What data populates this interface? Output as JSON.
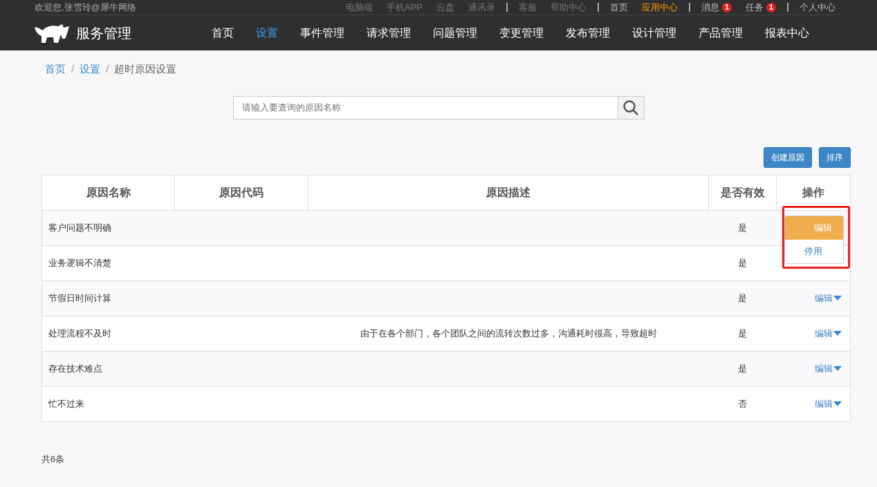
{
  "top_bar": {
    "welcome": "欢迎您,张雪玲@犀牛网络",
    "links": [
      {
        "label": "电脑端",
        "kind": "muted"
      },
      {
        "label": "手机APP",
        "kind": "muted"
      },
      {
        "label": "云盘",
        "kind": "muted"
      },
      {
        "label": "通讯录",
        "kind": "muted"
      },
      {
        "kind": "divider"
      },
      {
        "label": "客服",
        "kind": "muted"
      },
      {
        "label": "帮助中心",
        "kind": "muted"
      },
      {
        "kind": "divider"
      },
      {
        "label": "首页",
        "kind": "normal"
      },
      {
        "label": "应用中心",
        "kind": "highlight"
      },
      {
        "kind": "divider"
      },
      {
        "label": "消息",
        "kind": "normal",
        "badge": "1"
      },
      {
        "label": "任务",
        "kind": "normal",
        "badge": "1"
      },
      {
        "kind": "divider"
      },
      {
        "label": "个人中心",
        "kind": "normal"
      }
    ]
  },
  "nav": {
    "brand": "服务管理",
    "items": [
      {
        "label": "首页",
        "selected": false
      },
      {
        "label": "设置",
        "selected": true
      },
      {
        "label": "事件管理",
        "selected": false
      },
      {
        "label": "请求管理",
        "selected": false
      },
      {
        "label": "问题管理",
        "selected": false
      },
      {
        "label": "变更管理",
        "selected": false
      },
      {
        "label": "发布管理",
        "selected": false
      },
      {
        "label": "设计管理",
        "selected": false
      },
      {
        "label": "产品管理",
        "selected": false
      },
      {
        "label": "报表中心",
        "selected": false
      }
    ]
  },
  "breadcrumb": {
    "separator": "/",
    "items": [
      "首页",
      "设置",
      "超时原因设置"
    ]
  },
  "search": {
    "placeholder": "请输入要查询的原因名称"
  },
  "buttons": [
    "创建原因",
    "排序"
  ],
  "table": {
    "columns": [
      "原因名称",
      "原因代码",
      "原因描述",
      "是否有效",
      "操作"
    ],
    "rows": [
      {
        "name": "客户问题不明确",
        "valid": "是"
      },
      {
        "name": "业务逻辑不清楚",
        "valid": "是"
      },
      {
        "name": "节假日时间计算",
        "valid": "是",
        "action": "编辑"
      },
      {
        "name": "处理流程不及时",
        "description": "由于在各个部门，各个团队之间的流转次数过多，沟通耗时很高，导致超时",
        "valid": "是",
        "action": "编辑"
      },
      {
        "name": "存在技术难点",
        "valid": "是",
        "action": "编辑"
      },
      {
        "name": "忙不过来",
        "valid": "否",
        "action": "编辑"
      }
    ]
  },
  "dropdown": {
    "items": [
      {
        "label": "编辑",
        "selected": true
      },
      {
        "label": "停用",
        "selected": false
      }
    ]
  },
  "footer": {
    "count": "共6条"
  }
}
